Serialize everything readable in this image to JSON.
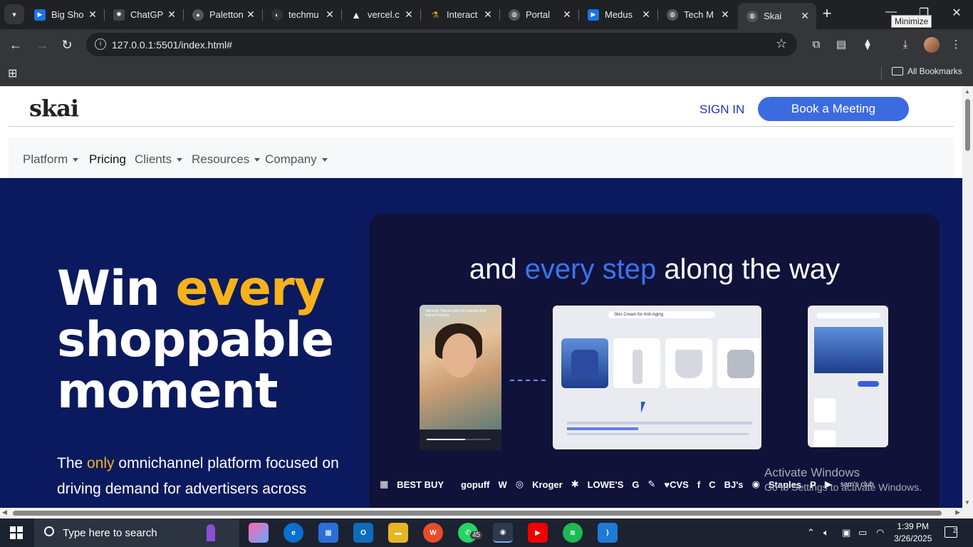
{
  "browser": {
    "tabs": [
      {
        "title": "Big Sho",
        "favicon": "play-icon",
        "color": "#1a73e8"
      },
      {
        "title": "ChatGP",
        "favicon": "openai-icon",
        "color": "#444444"
      },
      {
        "title": "Paletton",
        "favicon": "palette-icon",
        "color": "#555555"
      },
      {
        "title": "techmu",
        "favicon": "github-icon",
        "color": "#333333"
      },
      {
        "title": "vercel.c",
        "favicon": "vercel-icon",
        "color": "#000000"
      },
      {
        "title": "Interact",
        "favicon": "flask-icon",
        "color": "#c9a227"
      },
      {
        "title": "Portal",
        "favicon": "globe-icon",
        "color": "#555555"
      },
      {
        "title": "Medus",
        "favicon": "play-icon",
        "color": "#1a73e8"
      },
      {
        "title": "Tech M",
        "favicon": "globe-icon",
        "color": "#555555"
      },
      {
        "title": "Skai",
        "favicon": "globe-icon",
        "color": "#555555"
      }
    ],
    "close_glyph": "✕",
    "new_tab_glyph": "+",
    "tooltip": "Minimize",
    "url": "127.0.0.1:5501/index.html#",
    "bookmarks_label": "All Bookmarks"
  },
  "site": {
    "logo": "skai",
    "sign_in": "SIGN IN",
    "book_meeting": "Book a Meeting",
    "nav": [
      {
        "label": "Platform",
        "dropdown": true
      },
      {
        "label": "Pricing",
        "dropdown": false
      },
      {
        "label": "Clients",
        "dropdown": true
      },
      {
        "label": "Resources",
        "dropdown": true
      },
      {
        "label": "Company",
        "dropdown": true
      }
    ],
    "headline": {
      "word1": "Win ",
      "word2": "every",
      "line2": "shoppable",
      "line3": "moment"
    },
    "tagline": {
      "pre": "The ",
      "accent": "only",
      "post": " omnichannel platform focused on driving demand for advertisers across"
    },
    "card": {
      "title_pre": "and ",
      "title_accent": "every step",
      "title_post": " along the way",
      "search_text": "Skin Cream for Anti-Aging",
      "phone_caption": "Skincare Tutorial with my Favorite Anti-Aging Products",
      "logos": [
        "▦",
        "BEST BUY",
        "",
        "gopuff",
        "W",
        "◎",
        "Kroger",
        "✱",
        "LOWE'S",
        "G",
        "✎",
        "♥CVS",
        "f",
        "C",
        "BJ's",
        "◉",
        "Staples",
        "P",
        "▶",
        "sam's club"
      ]
    },
    "colors": {
      "hero_bg": "#0b1a5e",
      "accent_yellow": "#f6b21b",
      "accent_blue": "#3a74ef",
      "button_blue": "#3c6be0"
    }
  },
  "os": {
    "watermark_title": "Activate Windows",
    "watermark_sub": "Go to Settings to activate Windows.",
    "search_placeholder": "Type here to search",
    "whatsapp_badge": "45",
    "time": "1:39 PM",
    "date": "3/26/2025",
    "notification_count": "2"
  }
}
